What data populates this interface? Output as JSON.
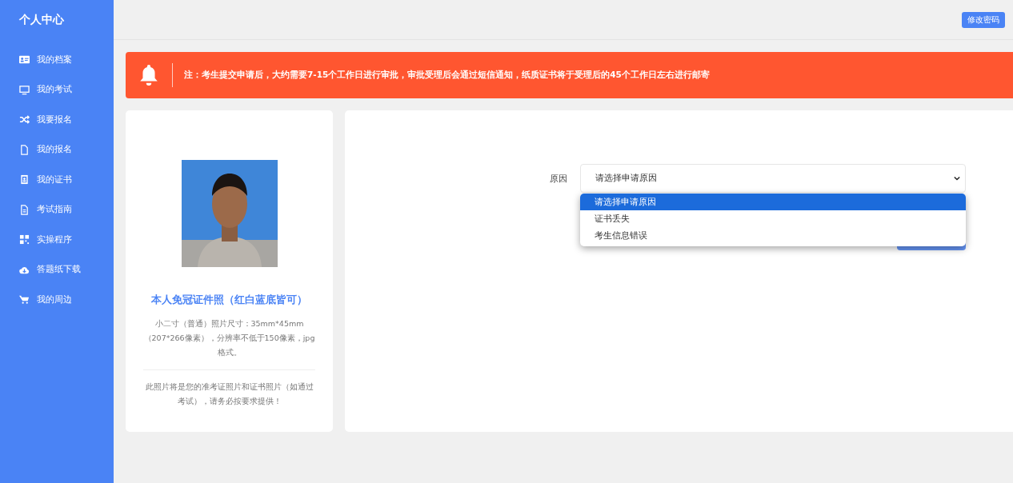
{
  "sidebar": {
    "title": "个人中心",
    "items": [
      {
        "label": "我的档案"
      },
      {
        "label": "我的考试"
      },
      {
        "label": "我要报名"
      },
      {
        "label": "我的报名"
      },
      {
        "label": "我的证书"
      },
      {
        "label": "考试指南"
      },
      {
        "label": "实操程序"
      },
      {
        "label": "答题纸下载"
      },
      {
        "label": "我的周边"
      }
    ]
  },
  "header": {
    "button": "修改密码"
  },
  "alert": {
    "text": "注：考生提交申请后，大约需要7-15个工作日进行审批，审批受理后会通过短信通知，纸质证书将于受理后的45个工作日左右进行邮寄"
  },
  "photo_card": {
    "title": "本人免冠证件照（红白蓝底皆可）",
    "description": "小二寸（普通）照片尺寸：35mm*45mm（207*266像素），分辨率不低于150像素，jpg格式。",
    "note": "此照片将是您的准考证照片和证书照片（如通过考试），请务必按要求提供！"
  },
  "form": {
    "label": "原因",
    "select": {
      "value": "请选择申请原因",
      "expanded": true,
      "options": [
        {
          "label": "请选择申请原因",
          "selected": true
        },
        {
          "label": "证书丢失",
          "selected": false
        },
        {
          "label": "考生信息错误",
          "selected": false
        }
      ]
    }
  }
}
